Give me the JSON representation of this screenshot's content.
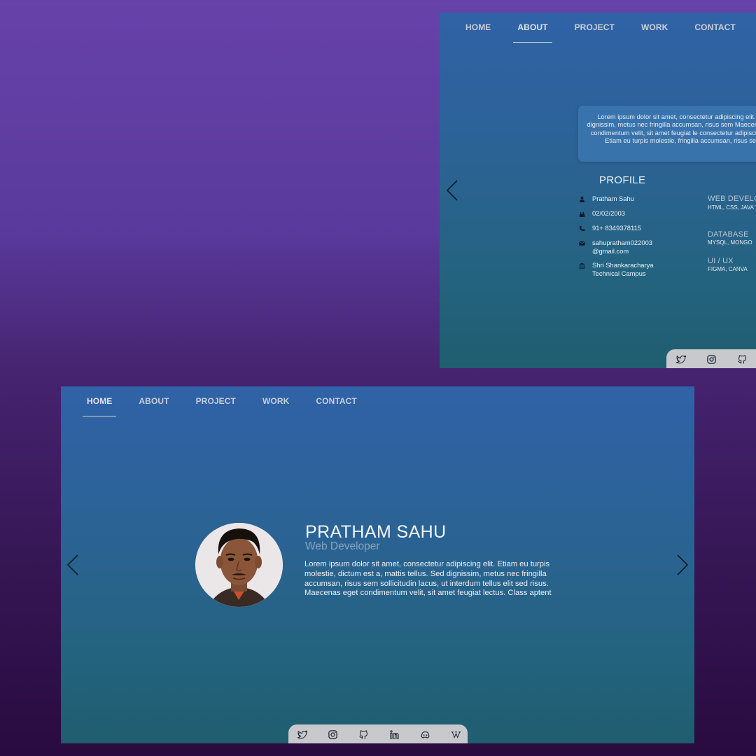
{
  "about_panel": {
    "nav": {
      "items": [
        "HOME",
        "ABOUT",
        "PROJECT",
        "WORK",
        "CONTACT"
      ],
      "active": "ABOUT"
    },
    "lorem_text": "Lorem ipsum dolor sit amet, consectetur adipiscing elit. Sed dignissim, metus nec fringilla accumsan, risus sem Maecenas eget condimentum velit, sit amet feugiat le consectetur adipiscing elit. Etiam eu turpis molestie, fringilla accumsan, risus sem",
    "profile": {
      "title": "PROFILE",
      "name": "Pratham Sahu",
      "dob": "02/02/2003",
      "phone": "91+ 8349378115",
      "email": "sahupratham022003 @gmail.com",
      "college": "Shri Shankaracharya Technical Campus"
    },
    "skills": [
      {
        "heading": "WEB DEVELO",
        "value": "HTML, CSS, JAVA TYPESCRIPT"
      },
      {
        "heading": "DATABASE",
        "value": "MYSQL, MONGO"
      },
      {
        "heading": "UI / UX",
        "value": "FIGMA, CANVA"
      }
    ],
    "social_icons": [
      "twitter-icon",
      "instagram-icon",
      "github-icon"
    ]
  },
  "home_panel": {
    "nav": {
      "items": [
        "HOME",
        "ABOUT",
        "PROJECT",
        "WORK",
        "CONTACT"
      ],
      "active": "HOME"
    },
    "name": "PRATHAM SAHU",
    "role": "Web Developer",
    "description": "Lorem ipsum dolor sit amet, consectetur adipiscing elit. Etiam eu turpis molestie, dictum est a, mattis tellus. Sed dignissim, metus nec fringilla accumsan, risus sem sollicitudin lacus, ut interdum tellus elit sed risus. Maecenas eget condimentum velit, sit amet feugiat lectus. Class aptent",
    "social_icons": [
      "twitter-icon",
      "instagram-icon",
      "github-icon",
      "linkedin-icon",
      "discord-icon",
      "wikipedia-icon"
    ]
  },
  "colors": {
    "page_bg_top": "#6642a9",
    "page_bg_bottom": "#290b40",
    "panel_top": "#3062a7",
    "panel_bottom": "#1f5d6f",
    "social_bar": "#c7c9cd",
    "nav_text": "#c9ced8"
  }
}
